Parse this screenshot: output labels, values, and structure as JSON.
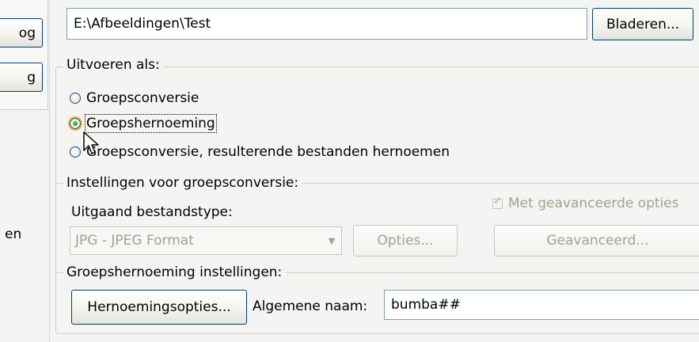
{
  "left_panel": {
    "button1_label": "og",
    "button2_label": "g",
    "label": "en"
  },
  "path": {
    "value": "E:\\Afbeeldingen\\Test",
    "browse_label": "Bladeren..."
  },
  "run_as": {
    "title": "Uitvoeren als:",
    "options": [
      {
        "label": "Groepsconversie",
        "checked": false
      },
      {
        "label": "Groepshernoeming",
        "checked": true
      },
      {
        "label": "Groepsconversie, resulterende bestanden hernoemen",
        "checked": false
      }
    ]
  },
  "conversion": {
    "title": "Instellingen voor groepsconversie:",
    "output_type_label": "Uitgaand bestandstype:",
    "advanced_checkbox_label": "Met geavanceerde opties",
    "advanced_checked": true,
    "format_value": "JPG - JPEG Format",
    "options_button": "Opties...",
    "advanced_button": "Geavanceerd..."
  },
  "rename": {
    "title": "Groepshernoeming instellingen:",
    "options_button": "Hernoemingsopties...",
    "name_label": "Algemene naam:",
    "name_value": "bumba##"
  },
  "colors": {
    "background": "#f4f4f2",
    "button_border": "#003c74",
    "input_border": "#7f9db9",
    "disabled_text": "#a1a192"
  }
}
